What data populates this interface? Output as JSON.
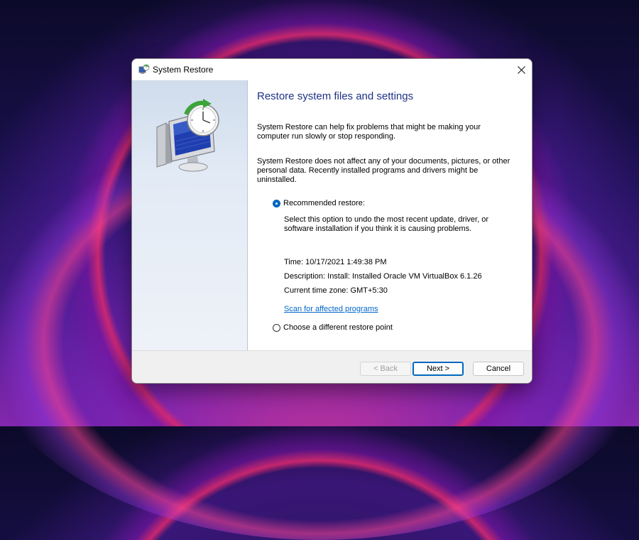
{
  "window": {
    "title": "System Restore",
    "close_symbol": "✕"
  },
  "icons": {
    "title_icon": "system-restore-icon",
    "hero_icon": "computer-with-clock-restore-icon",
    "close_icon": "close-icon"
  },
  "main": {
    "heading": "Restore system files and settings",
    "para1": "System Restore can help fix problems that might be making your computer run slowly or stop responding.",
    "para2": "System Restore does not affect any of your documents, pictures, or other personal data. Recently installed programs and drivers might be uninstalled."
  },
  "options": {
    "recommended": {
      "label": "Recommended restore:",
      "selected": true,
      "description": "Select this option to undo the most recent update, driver, or software installation if you think it is causing problems.",
      "time": "Time: 10/17/2021 1:49:38 PM",
      "restore_description": "Description: Install: Installed Oracle VM VirtualBox 6.1.26",
      "timezone": "Current time zone: GMT+5:30",
      "scan_link": "Scan for affected programs"
    },
    "different": {
      "label": "Choose a different restore point",
      "selected": false
    }
  },
  "footer": {
    "back_label": "< Back",
    "next_label": "Next >",
    "cancel_label": "Cancel"
  },
  "colors": {
    "heading": "#1e3287",
    "accent": "#0067c0",
    "link": "#0066cc"
  }
}
